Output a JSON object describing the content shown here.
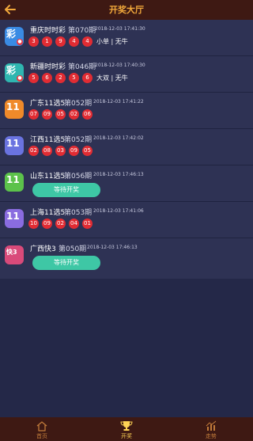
{
  "header": {
    "title": "开奖大厅",
    "back_icon": "back-arrow-icon"
  },
  "lotteries": [
    {
      "name": "重庆时时彩",
      "issue": "第070期",
      "time": "2018-12-03 17:41:30",
      "balls": [
        "3",
        "1",
        "9",
        "4",
        "4"
      ],
      "extra": "小单 | 无牛",
      "status": "",
      "logo_color": "#3a8be4",
      "logo_mark": "彩"
    },
    {
      "name": "新疆时时彩",
      "issue": "第046期",
      "time": "2018-12-03 17:40:30",
      "balls": [
        "5",
        "6",
        "2",
        "5",
        "6"
      ],
      "extra": "大双 | 无牛",
      "status": "",
      "logo_color": "#2fb6b0",
      "logo_mark": "彩"
    },
    {
      "name": "广东11选5",
      "issue": "第052期",
      "time": "2018-12-03 17:41:22",
      "balls": [
        "07",
        "09",
        "05",
        "02",
        "06"
      ],
      "extra": "",
      "status": "",
      "logo_color": "#f08a2a",
      "logo_mark": "11"
    },
    {
      "name": "江西11选5",
      "issue": "第052期",
      "time": "2018-12-03 17:42:02",
      "balls": [
        "02",
        "08",
        "03",
        "09",
        "05"
      ],
      "extra": "",
      "status": "",
      "logo_color": "#6a73e0",
      "logo_mark": "11"
    },
    {
      "name": "山东11选5",
      "issue": "第056期",
      "time": "2018-12-03 17:46:13",
      "balls": [],
      "extra": "",
      "status": "等待开奖",
      "logo_color": "#5cc24b",
      "logo_mark": "11"
    },
    {
      "name": "上海11选5",
      "issue": "第053期",
      "time": "2018-12-03 17:41:06",
      "balls": [
        "10",
        "09",
        "02",
        "04",
        "01"
      ],
      "extra": "",
      "status": "",
      "logo_color": "#8a6ce0",
      "logo_mark": "11"
    },
    {
      "name": "广西快3",
      "issue": "第050期",
      "time": "2018-12-03 17:46:13",
      "balls": [],
      "extra": "",
      "status": "等待开奖",
      "logo_color": "#d94a7a",
      "logo_mark": "快3"
    }
  ],
  "tabbar": [
    {
      "label": "首页",
      "icon": "home-icon",
      "active": false
    },
    {
      "label": "开奖",
      "icon": "trophy-icon",
      "active": true
    },
    {
      "label": "走势",
      "icon": "trend-chart-icon",
      "active": false
    }
  ],
  "colors": {
    "ball": "#e12c33",
    "wait_button": "#3ec7a5",
    "header": "#3e1913",
    "accent": "#f2a93b"
  }
}
